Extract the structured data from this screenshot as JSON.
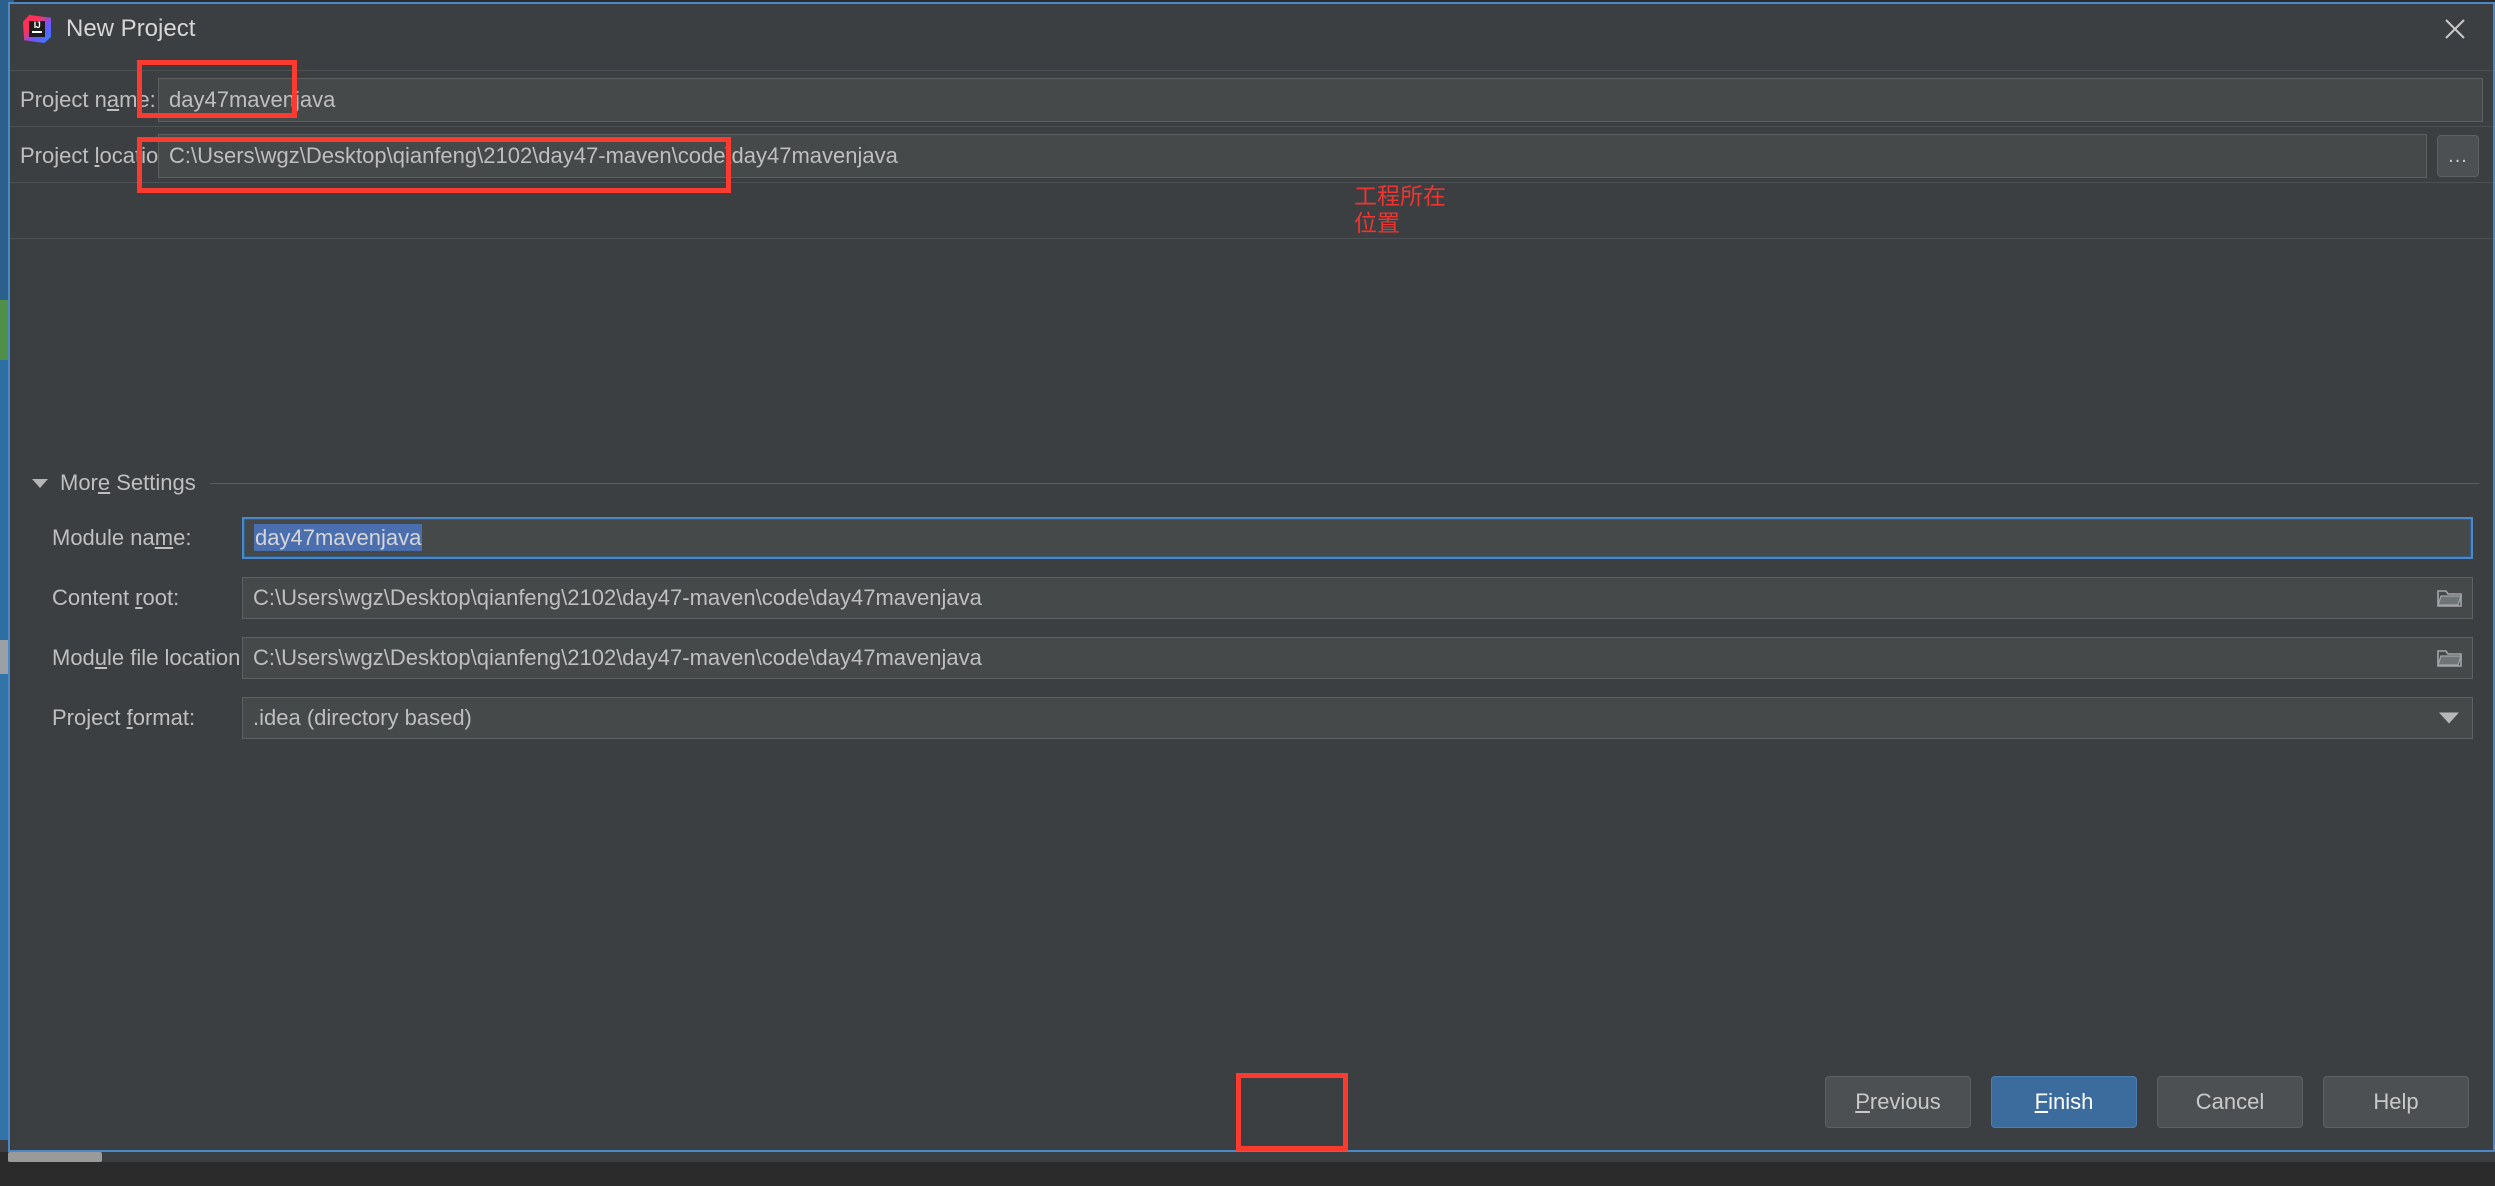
{
  "window": {
    "title": "New Project",
    "logo_icon": "intellij-idea-logo",
    "close_icon": "close-icon"
  },
  "top_form": {
    "project_name": {
      "label": "Project name:",
      "value": "day47mavenjava",
      "mnemonic": "a"
    },
    "project_location": {
      "label": "Project location:",
      "value": "C:\\Users\\wgz\\Desktop\\qianfeng\\2102\\day47-maven\\code\\day47mavenjava",
      "mnemonic": "l",
      "browse_button_label": "..."
    }
  },
  "annotation": {
    "text": "工程所在\n位置",
    "color": "#f0342f"
  },
  "more_settings": {
    "header": "More Settings",
    "collapse_icon": "chevron-down-icon",
    "rows": [
      {
        "label": "Module name:",
        "value": "day47mavenjava",
        "focused": true,
        "selected": true,
        "trailing_icon": null
      },
      {
        "label": "Content root:",
        "value": "C:\\Users\\wgz\\Desktop\\qianfeng\\2102\\day47-maven\\code\\day47mavenjava",
        "focused": false,
        "selected": false,
        "trailing_icon": "folder-icon"
      },
      {
        "label": "Module file location:",
        "value": "C:\\Users\\wgz\\Desktop\\qianfeng\\2102\\day47-maven\\code\\day47mavenjava",
        "focused": false,
        "selected": false,
        "trailing_icon": "folder-icon"
      },
      {
        "label": "Project format:",
        "value": ".idea (directory based)",
        "focused": false,
        "selected": false,
        "trailing_icon": "chevron-down-icon"
      }
    ]
  },
  "buttons": {
    "previous": "Previous",
    "finish": "Finish",
    "cancel": "Cancel",
    "help": "Help"
  },
  "colors": {
    "dialog_bg": "#3c3f41",
    "field_bg": "#45494a",
    "text": "#bfbfbf",
    "primary_button": "#3c6b9e",
    "focus_border": "#4b88c7",
    "selection": "#4b6eaf",
    "annotation_red": "#f0342f",
    "highlight_box_red": "#fb3b30"
  }
}
